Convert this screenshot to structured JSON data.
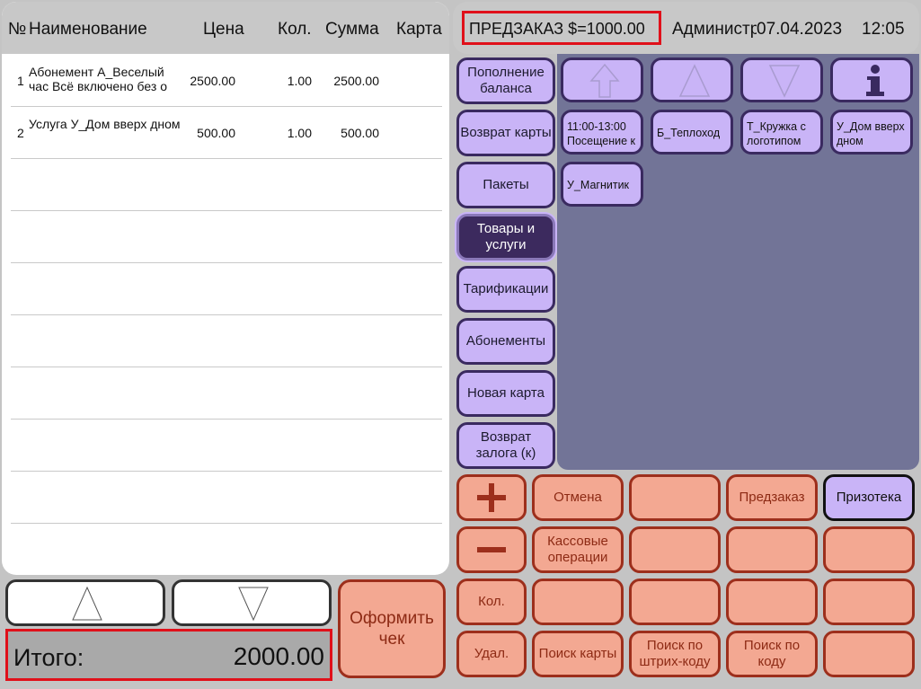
{
  "receipt": {
    "headers": {
      "num": "№",
      "name": "Наименование",
      "price": "Цена",
      "qty": "Кол.",
      "sum": "Сумма",
      "card": "Карта"
    },
    "rows": [
      {
        "num": "1",
        "name": "Абонемент А_Веселый час Всё включено без о",
        "price": "2500.00",
        "qty": "1.00",
        "sum": "2500.00",
        "card": ""
      },
      {
        "num": "2",
        "name": "Услуга У_Дом вверх дном",
        "price": "500.00",
        "qty": "1.00",
        "sum": "500.00",
        "card": ""
      }
    ]
  },
  "total": {
    "label": "Итого:",
    "value": "2000.00"
  },
  "checkout": {
    "label": "Оформить чек"
  },
  "status": {
    "prezakaz": "ПРЕДЗАКАЗ $=1000.00",
    "admin": "Администратор",
    "date": "07.04.2023",
    "time": "12:05"
  },
  "categories": [
    "Пополнение баланса",
    "Возврат карты",
    "Пакеты",
    "Товары и услуги",
    "Тарификации",
    "Абонементы",
    "Новая карта",
    "Возврат залога (к)"
  ],
  "products": [
    "11:00-13:00 Посещение к",
    "Б_Теплоход",
    "Т_Кружка с логотипом",
    "У_Дом вверх дном",
    "У_Магнитик"
  ],
  "actions": {
    "plus": "+",
    "minus": "−",
    "qty": "Кол.",
    "delete": "Удал.",
    "cancel": "Отмена",
    "cash_ops": "Кассовые операции",
    "search_card": "Поиск карты",
    "search_barcode": "Поиск по штрих-коду",
    "preorder": "Предзаказ",
    "search_code": "Поиск по коду",
    "prizoteka": "Призотека"
  },
  "colors": {
    "category_bg": "#c9b4f7",
    "category_active_bg": "#3c2a5e",
    "product_area": "#727497",
    "action_bg": "#f3a892",
    "action_text": "#8d2a14",
    "highlight": "#e0101a"
  },
  "icons": {
    "nav": [
      "arrow-up-thick-icon",
      "triangle-up-icon",
      "triangle-down-icon",
      "info-icon"
    ],
    "scroll": [
      "triangle-up-icon",
      "triangle-down-icon"
    ]
  }
}
